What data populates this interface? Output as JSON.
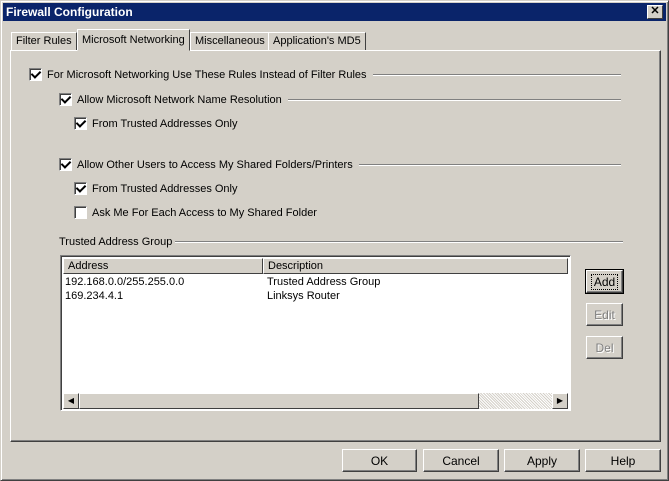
{
  "window": {
    "title": "Firewall Configuration",
    "close_glyph": "✕"
  },
  "tabs": [
    {
      "label": "Filter Rules",
      "active": false
    },
    {
      "label": "Microsoft Networking",
      "active": true
    },
    {
      "label": "Miscellaneous",
      "active": false
    },
    {
      "label": "Application's MD5",
      "active": false
    }
  ],
  "options": {
    "use_ms_rules": {
      "label": "For Microsoft Networking Use These Rules Instead of Filter Rules",
      "checked": true
    },
    "allow_name_resolution": {
      "label": "Allow Microsoft Network Name Resolution",
      "checked": true
    },
    "name_res_trusted_only": {
      "label": "From Trusted Addresses Only",
      "checked": true
    },
    "allow_shared_access": {
      "label": "Allow Other Users to Access My Shared Folders/Printers",
      "checked": true
    },
    "shared_trusted_only": {
      "label": "From Trusted Addresses Only",
      "checked": true
    },
    "ask_each_access": {
      "label": "Ask Me For Each Access to My Shared Folder",
      "checked": false
    }
  },
  "trusted_group": {
    "label": "Trusted Address Group",
    "columns": [
      "Address",
      "Description"
    ],
    "rows": [
      [
        "192.168.0.0/255.255.0.0",
        "Trusted Address Group"
      ],
      [
        "169.234.4.1",
        "Linksys Router"
      ]
    ]
  },
  "side_buttons": {
    "add": "Add",
    "edit": "Edit",
    "del": "Del"
  },
  "footer_buttons": {
    "ok": "OK",
    "cancel": "Cancel",
    "apply": "Apply",
    "help": "Help"
  },
  "scrollbar": {
    "left_arrow": "◀",
    "right_arrow": "▶"
  }
}
